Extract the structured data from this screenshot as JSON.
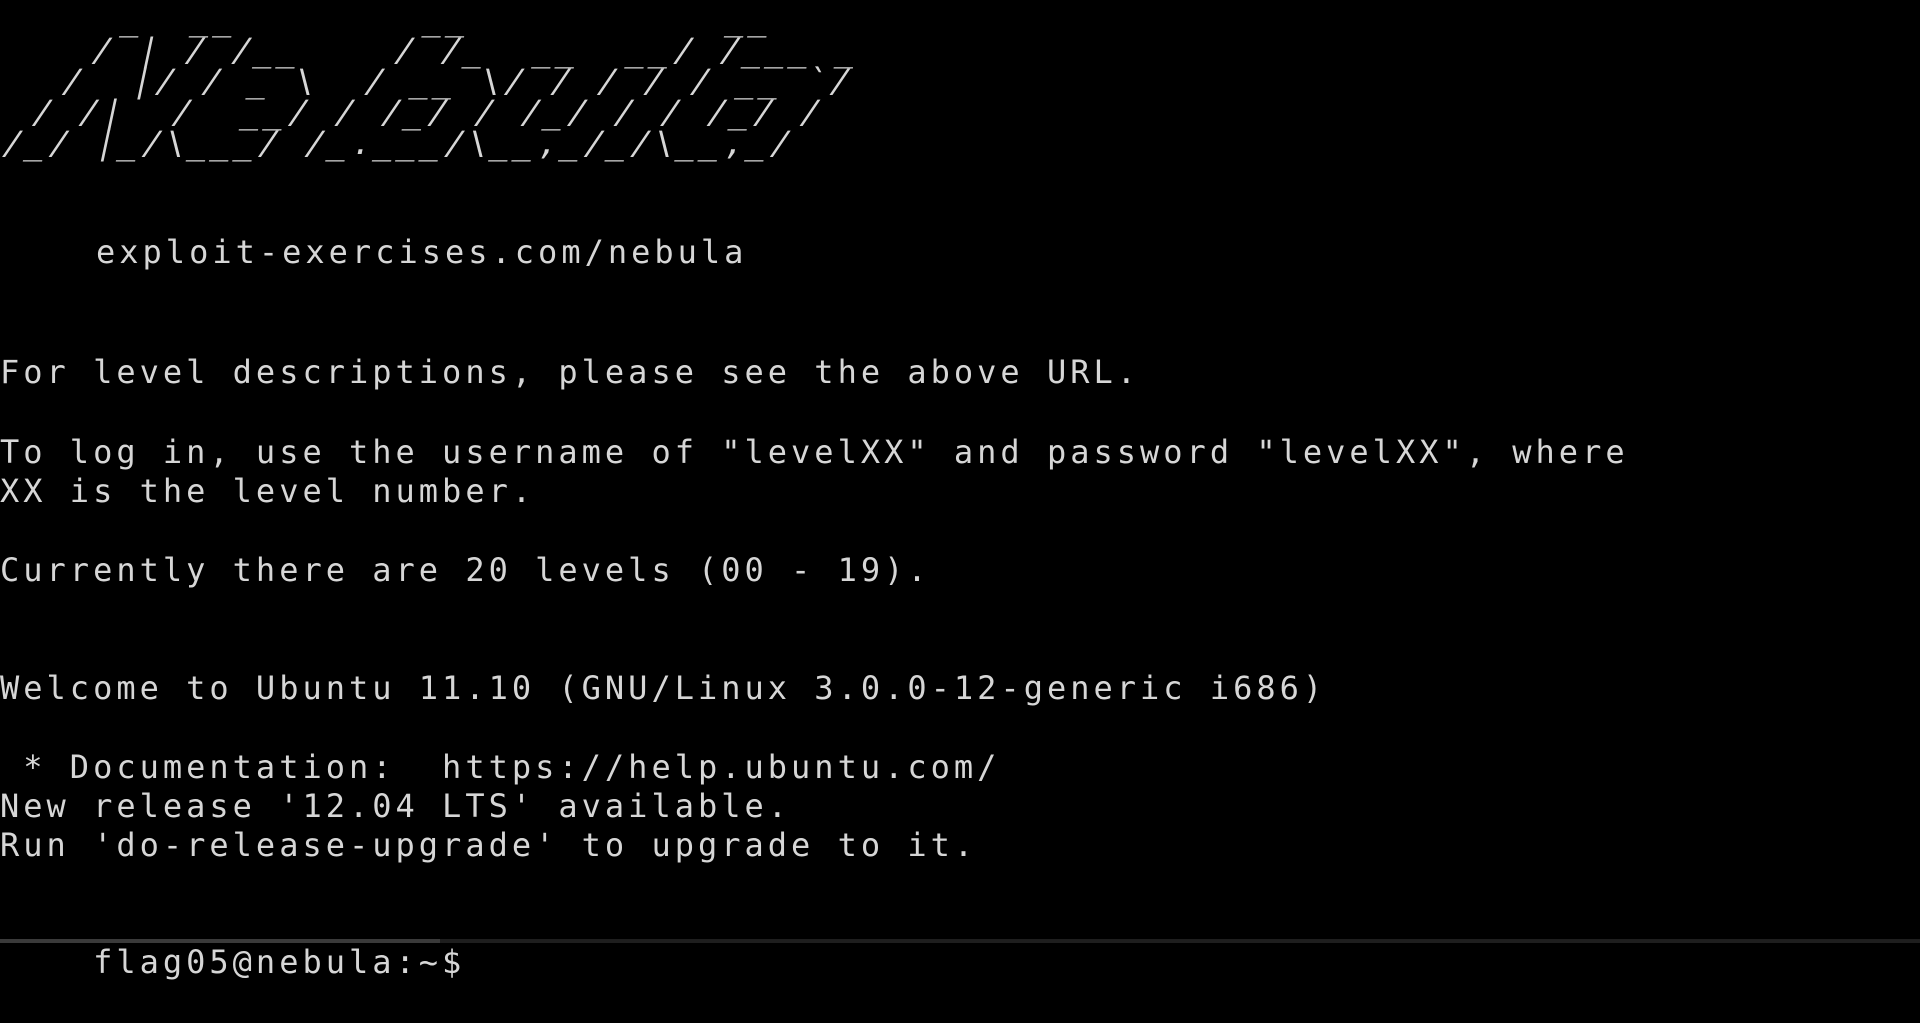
{
  "colors": {
    "background": "#000000",
    "foreground": "#d6d6d6",
    "bar": "#1e1e1e",
    "bar_accent": "#3a3a3a"
  },
  "banner": {
    "ascii_art": "    _  __        __           __\n   / | / /__    / /_  __  __/ /___ _\n  /  |/ / _ \\  / __ \\/ / / / / __ `/\n / /|  /  __/ / /_/ / /_/ / / /_/ /\n/_/ |_/\\___/ /_.___/\\__,_/_/\\__,_/",
    "url": "exploit-exercises.com/nebula"
  },
  "motd": {
    "line_1": "For level descriptions, please see the above URL.",
    "line_2a": "To log in, use the username of \"levelXX\" and password \"levelXX\", where",
    "line_2b": "XX is the level number.",
    "line_3": "Currently there are 20 levels (00 - 19).",
    "welcome": "Welcome to Ubuntu 11.10 (GNU/Linux 3.0.0-12-generic i686)",
    "documentation": " * Documentation:  https://help.ubuntu.com/",
    "release_notice": "New release '12.04 LTS' available.",
    "upgrade_hint": "Run 'do-release-upgrade' to upgrade to it."
  },
  "prompt": {
    "text": "flag05@nebula:~$ "
  }
}
